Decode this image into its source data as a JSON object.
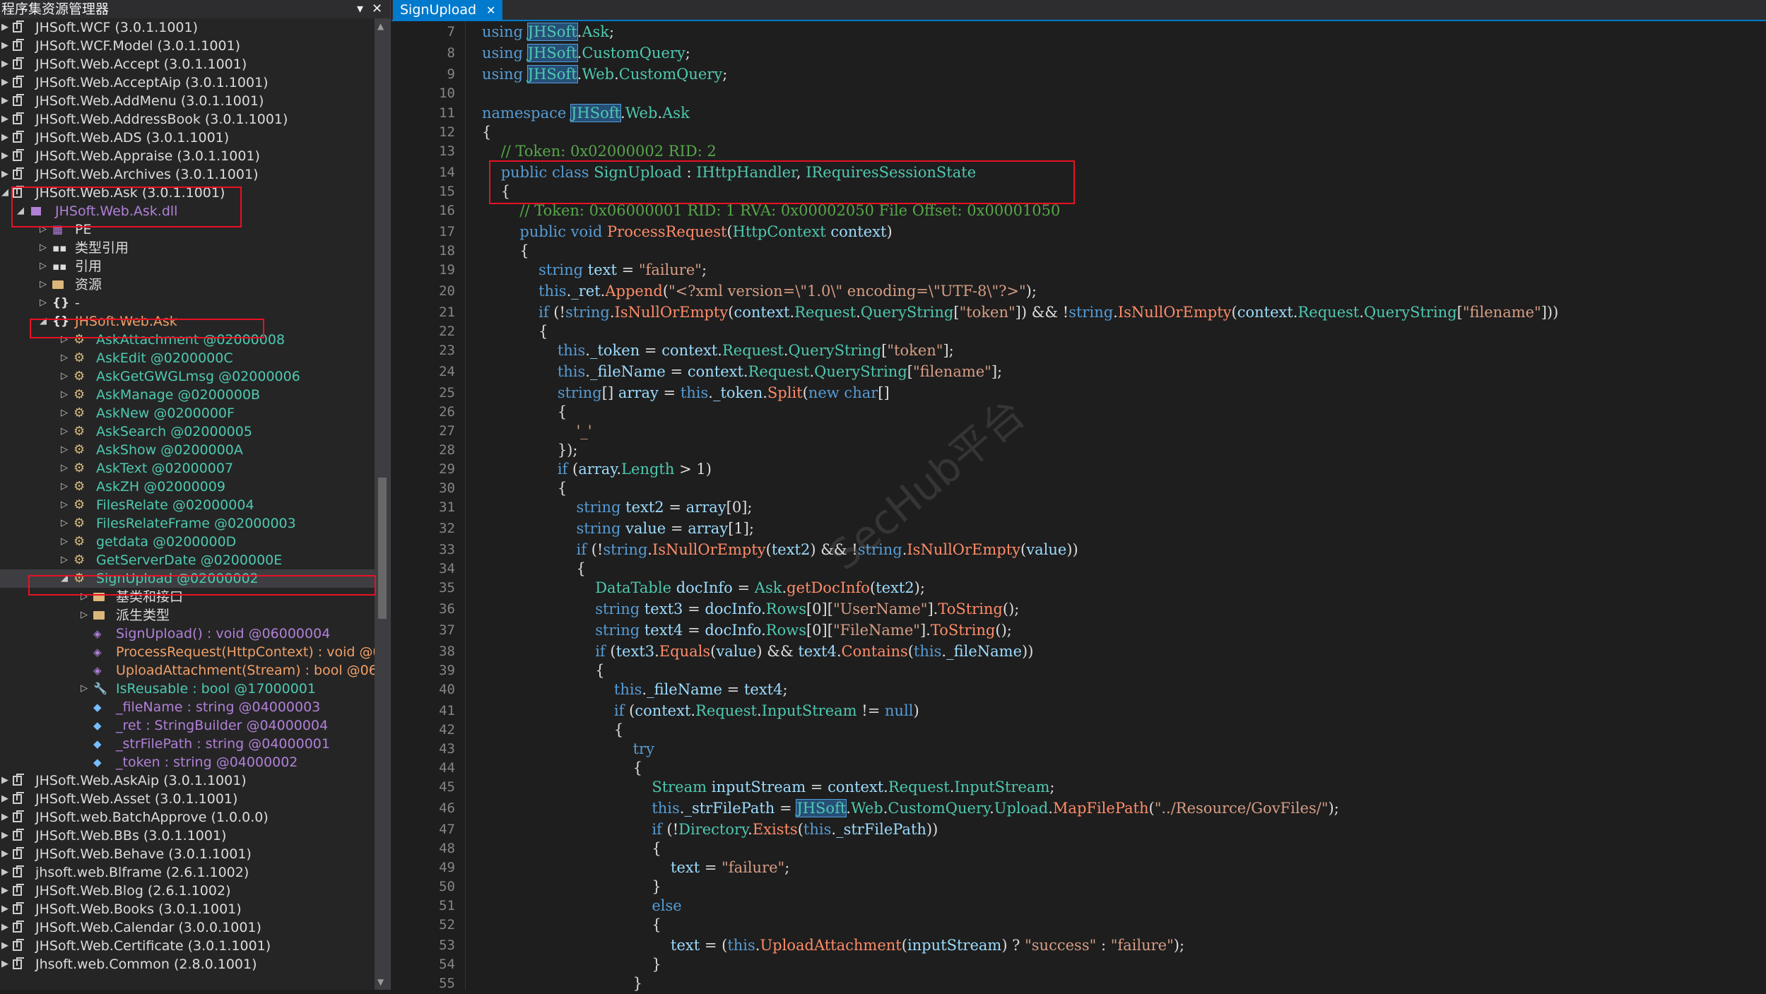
{
  "assembly_explorer": {
    "title": "程序集资源管理器",
    "items": [
      {
        "label": "JHSoft.WCF (3.0.1.1001)"
      },
      {
        "label": "JHSoft.WCF.Model (3.0.1.1001)"
      },
      {
        "label": "JHSoft.Web.Accept (3.0.1.1001)"
      },
      {
        "label": "JHSoft.Web.AcceptAip (3.0.1.1001)"
      },
      {
        "label": "JHSoft.Web.AddMenu (3.0.1.1001)"
      },
      {
        "label": "JHSoft.Web.AddressBook (3.0.1.1001)"
      },
      {
        "label": "JHSoft.Web.ADS (3.0.1.1001)"
      },
      {
        "label": "JHSoft.Web.Appraise (3.0.1.1001)"
      },
      {
        "label": "JHSoft.Web.Archives (3.0.1.1001)"
      },
      {
        "label": "JHSoft.Web.Ask (3.0.1.1001)"
      },
      {
        "label": "JHSoft.Web.Ask.dll"
      },
      {
        "label": "PE"
      },
      {
        "label": "类型引用"
      },
      {
        "label": "引用"
      },
      {
        "label": "资源"
      },
      {
        "label": "-"
      },
      {
        "label": "JHSoft.Web.Ask"
      },
      {
        "label": "AskAttachment @02000008"
      },
      {
        "label": "AskEdit @0200000C"
      },
      {
        "label": "AskGetGWGLmsg @02000006"
      },
      {
        "label": "AskManage @0200000B"
      },
      {
        "label": "AskNew @0200000F"
      },
      {
        "label": "AskSearch @02000005"
      },
      {
        "label": "AskShow @0200000A"
      },
      {
        "label": "AskText @02000007"
      },
      {
        "label": "AskZH @02000009"
      },
      {
        "label": "FilesRelate @02000004"
      },
      {
        "label": "FilesRelateFrame @02000003"
      },
      {
        "label": "getdata @0200000D"
      },
      {
        "label": "GetServerDate @0200000E"
      },
      {
        "label": "SignUpload @02000002"
      },
      {
        "label": "基类和接口"
      },
      {
        "label": "派生类型"
      },
      {
        "label": "SignUpload() : void @06000004"
      },
      {
        "label": "ProcessRequest(HttpContext) : void @060"
      },
      {
        "label": "UploadAttachment(Stream) : bool @0600"
      },
      {
        "label": "IsReusable : bool @17000001"
      },
      {
        "label": "_fileName : string @04000003"
      },
      {
        "label": "_ret : StringBuilder @04000004"
      },
      {
        "label": "_strFilePath : string @04000001"
      },
      {
        "label": "_token : string @04000002"
      },
      {
        "label": "JHSoft.Web.AskAip (3.0.1.1001)"
      },
      {
        "label": "JHSoft.Web.Asset (3.0.1.1001)"
      },
      {
        "label": "JHSoft.web.BatchApprove (1.0.0.0)"
      },
      {
        "label": "JHSoft.Web.BBs (3.0.1.1001)"
      },
      {
        "label": "JHSoft.Web.Behave (3.0.1.1001)"
      },
      {
        "label": "jhsoft.web.Blframe (2.6.1.1002)"
      },
      {
        "label": "JHSoft.Web.Blog (2.6.1.1002)"
      },
      {
        "label": "JHSoft.Web.Books (3.0.1.1001)"
      },
      {
        "label": "JHSoft.Web.Calendar (3.0.0.1001)"
      },
      {
        "label": "JHSoft.Web.Certificate (3.0.1.1001)"
      },
      {
        "label": "Jhsoft.web.Common (2.8.0.1001)"
      }
    ]
  },
  "editor": {
    "tab_label": "SignUpload",
    "line_numbers": [
      "7",
      "8",
      "9",
      "10",
      "11",
      "12",
      "13",
      "14",
      "15",
      "16",
      "17",
      "18",
      "19",
      "20",
      "21",
      "22",
      "23",
      "24",
      "25",
      "26",
      "27",
      "28",
      "29",
      "30",
      "31",
      "32",
      "33",
      "34",
      "35",
      "36",
      "37",
      "38",
      "39",
      "40",
      "41",
      "42",
      "43",
      "44",
      "45",
      "46",
      "47",
      "48",
      "49",
      "50",
      "51",
      "52",
      "53",
      "54",
      "55"
    ]
  },
  "watermark": "SecHub平台"
}
